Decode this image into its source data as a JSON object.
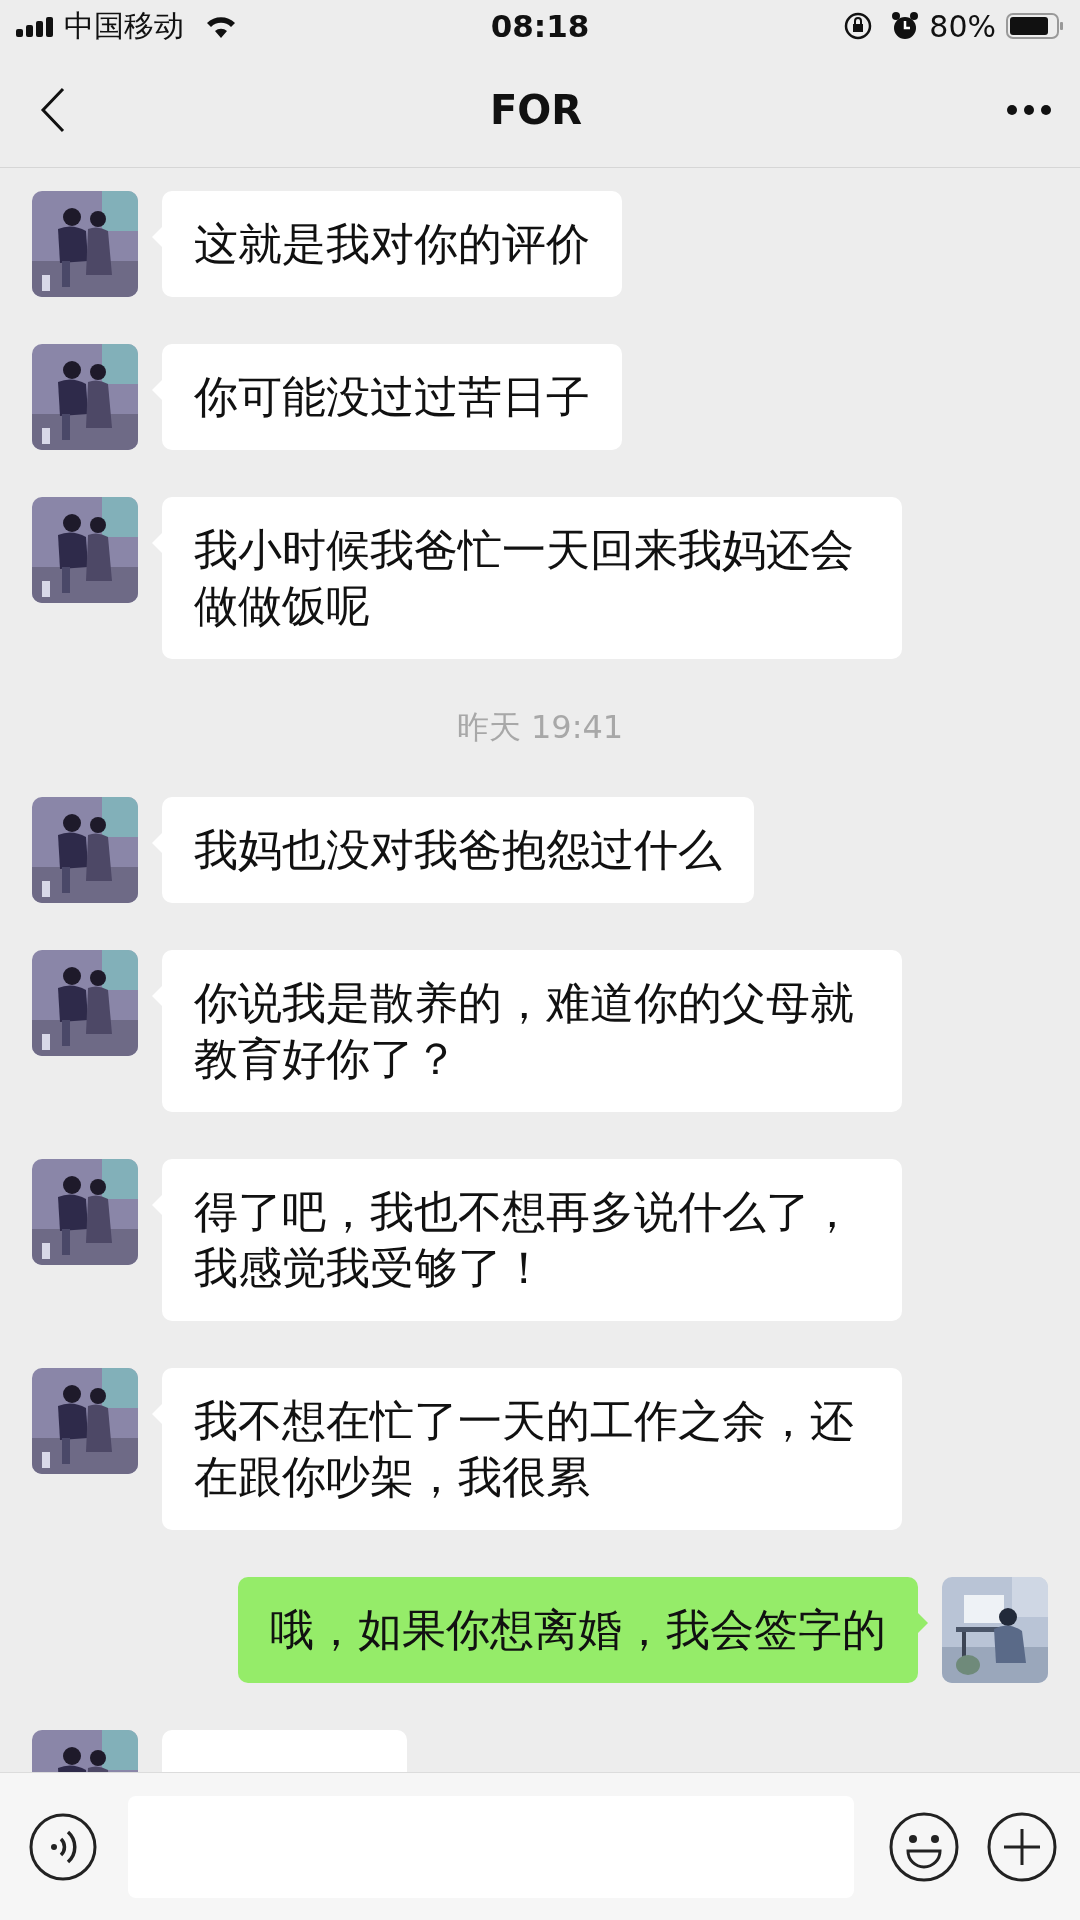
{
  "status_bar": {
    "carrier": "中国移动",
    "time": "08:18",
    "battery": "80%"
  },
  "header": {
    "title": "FOR"
  },
  "messages": [
    {
      "kind": "received",
      "text": "这就是我对你的评价"
    },
    {
      "kind": "received",
      "text": "你可能没过过苦日子"
    },
    {
      "kind": "received",
      "text": "我小时候我爸忙一天回来我妈还会做做饭呢"
    },
    {
      "kind": "time",
      "text": "昨天 19:41"
    },
    {
      "kind": "received",
      "text": "我妈也没对我爸抱怨过什么"
    },
    {
      "kind": "received",
      "text": "你说我是散养的，难道你的父母就教育好你了？"
    },
    {
      "kind": "received",
      "text": "得了吧，我也不想再多说什么了，我感觉我受够了！"
    },
    {
      "kind": "received",
      "text": "我不想在忙了一天的工作之余，还在跟你吵架，我很累"
    },
    {
      "kind": "sent",
      "text": "哦，如果你想离婚，我会签字的"
    },
    {
      "kind": "partial"
    }
  ]
}
